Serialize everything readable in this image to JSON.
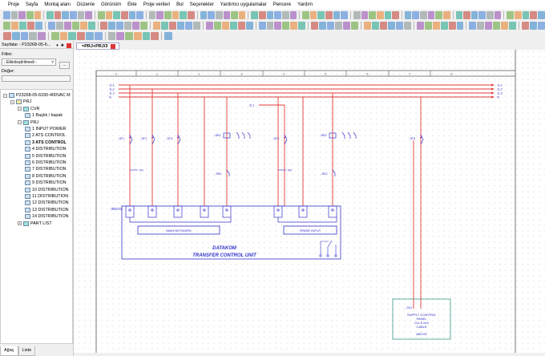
{
  "menu": [
    "Proje",
    "Sayfa",
    "Montaj alanı",
    "Düzenle",
    "Görünüm",
    "Ekle",
    "Proje verileri",
    "Bul",
    "Seçenekler",
    "Yardımcı uygulamalar",
    "Pencere",
    "Yardım"
  ],
  "left_panel": {
    "title": "Sayfalar - P23268-05-6...",
    "filter_label": "Filtre:",
    "filter_value": "- Etkinleştirilmedi -",
    "filter_button": "...",
    "value_label": "Değer:",
    "value_input": "",
    "tree": [
      {
        "label": "P23268-05-6330-400VAC M",
        "level": 0,
        "type": "project"
      },
      {
        "label": "PRJ",
        "level": 1,
        "type": "folder"
      },
      {
        "label": "CVR",
        "level": 2,
        "type": "group"
      },
      {
        "label": "1 Başlık / kapak",
        "level": 3,
        "type": "page"
      },
      {
        "label": "PRJ",
        "level": 2,
        "type": "group"
      },
      {
        "label": "1 INPUT POWER",
        "level": 3,
        "type": "page"
      },
      {
        "label": "2 ATS CONTROL",
        "level": 3,
        "type": "page"
      },
      {
        "label": "3 ATS CONTROL",
        "level": 3,
        "type": "page",
        "selected": true
      },
      {
        "label": "4 DISTRIBUTION",
        "level": 3,
        "type": "page"
      },
      {
        "label": "5 DISTRIBUTION",
        "level": 3,
        "type": "page"
      },
      {
        "label": "6 DISTRIBUTION",
        "level": 3,
        "type": "page"
      },
      {
        "label": "7 DISTRIBUTION",
        "level": 3,
        "type": "page"
      },
      {
        "label": "8 DISTRIBUTION",
        "level": 3,
        "type": "page"
      },
      {
        "label": "9 DISTRIBUTION",
        "level": 3,
        "type": "page"
      },
      {
        "label": "10 DISTRIBUTION",
        "level": 3,
        "type": "page"
      },
      {
        "label": "11 DISTRIBUTION",
        "level": 3,
        "type": "page"
      },
      {
        "label": "12 DISTRIBUTION",
        "level": 3,
        "type": "page"
      },
      {
        "label": "13 DISTRIBUTION",
        "level": 3,
        "type": "page"
      },
      {
        "label": "14 DISTRIBUTION",
        "level": 3,
        "type": "page"
      },
      {
        "label": "PART LIST",
        "level": 2,
        "type": "group"
      }
    ],
    "bottom_tabs": [
      "Ağaç",
      "Liste"
    ]
  },
  "document_tab": "=PRJ+PRJ/3",
  "diagram": {
    "bus_left": [
      "1L1",
      "1L2",
      "1L3",
      "N"
    ],
    "bus_right": [
      "1L1",
      "1L2",
      "1L3",
      "N"
    ],
    "aux_bus": "2L1",
    "column_numbers": [
      "0",
      "1",
      "2",
      "3",
      "4",
      "5",
      "6",
      "7",
      "8"
    ],
    "breakers": [
      "-3F1",
      "-3F2",
      "-3F3",
      "-3F4",
      "-3F5"
    ],
    "relays": [
      "-3R1",
      "-3R2"
    ],
    "relay_contacts": [
      "-3R1",
      "-3R2"
    ],
    "wire_tags": [
      "R1",
      "R2"
    ],
    "controller_tag": "-3DK01",
    "main_network": "MAIN NETWORK",
    "spare_input": "SPARE INPUT",
    "brand": "DATAKOM",
    "unit_title": "TRANSFER CONTROL UNIT",
    "supply_box": {
      "tag": "-3X1",
      "lines": [
        "SUPPLY CONTROL",
        "PANEL",
        "2x1,5 mm",
        "CABLE"
      ],
      "note": "ABOVE"
    }
  },
  "colors": {
    "wire": "#e53935",
    "device": "#3333cc",
    "grid": "#c8c8c8",
    "supply_box": "#3a9a8a"
  }
}
